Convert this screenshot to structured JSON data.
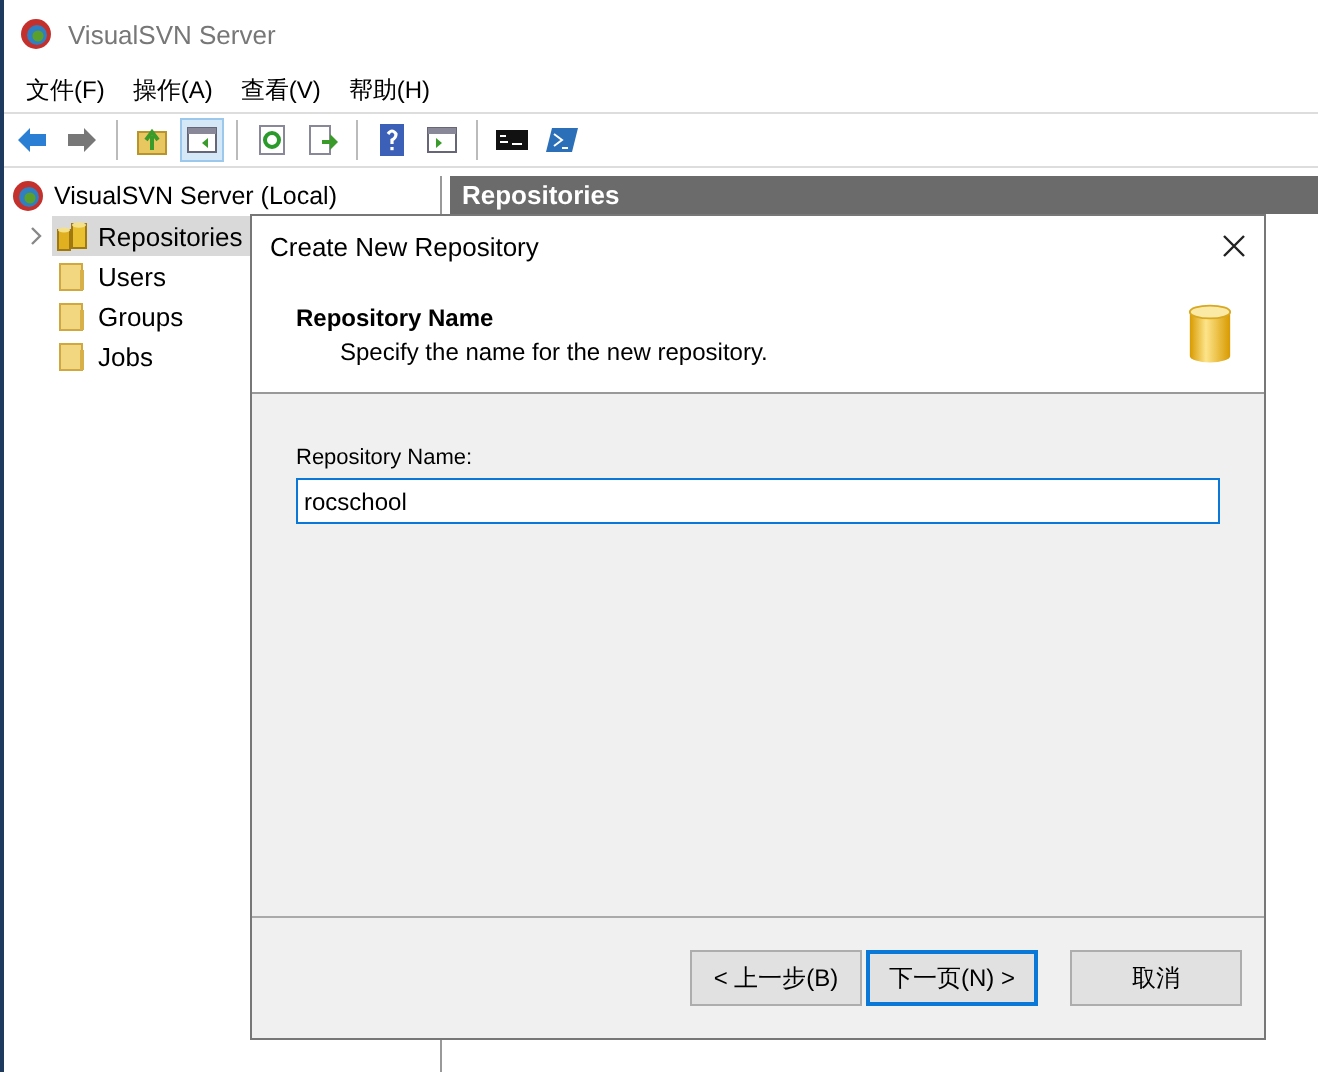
{
  "window": {
    "title": "VisualSVN Server"
  },
  "menu": [
    "文件(F)",
    "操作(A)",
    "查看(V)",
    "帮助(H)"
  ],
  "toolbar": [
    [
      {
        "kind": "back",
        "selected": false
      },
      {
        "kind": "forward",
        "selected": false
      }
    ],
    [
      {
        "kind": "up",
        "selected": false
      },
      {
        "kind": "pane",
        "selected": true
      }
    ],
    [
      {
        "kind": "refresh",
        "selected": false
      },
      {
        "kind": "export",
        "selected": false
      }
    ],
    [
      {
        "kind": "help",
        "selected": false
      },
      {
        "kind": "pane2",
        "selected": false
      }
    ],
    [
      {
        "kind": "console",
        "selected": false
      },
      {
        "kind": "shell",
        "selected": false
      }
    ]
  ],
  "tree": {
    "label": "VisualSVN Server (Local)",
    "children": [
      {
        "label": "Repositories",
        "kind": "repo",
        "selected": true,
        "expandable": true
      },
      {
        "label": "Users",
        "kind": "folder",
        "selected": false,
        "expandable": false
      },
      {
        "label": "Groups",
        "kind": "folder",
        "selected": false,
        "expandable": false
      },
      {
        "label": "Jobs",
        "kind": "folder",
        "selected": false,
        "expandable": false
      }
    ]
  },
  "panel": {
    "title": "Repositories"
  },
  "dialog": {
    "title": "Create New Repository",
    "heading": "Repository Name",
    "subheading": "Specify the name for the new repository.",
    "field_label": "Repository Name:",
    "field_value": "rocschool",
    "buttons": [
      {
        "label": "< 上一步(B)",
        "focused": false
      },
      {
        "label": "下一页(N) >",
        "focused": true
      },
      {
        "label": "取消",
        "focused": false
      }
    ]
  }
}
